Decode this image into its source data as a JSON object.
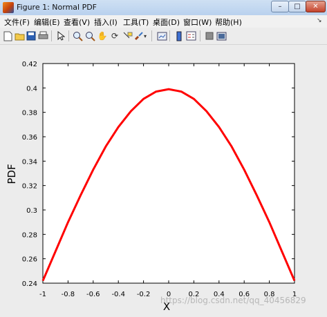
{
  "window": {
    "title": "Figure 1: Normal PDF"
  },
  "menu": [
    {
      "label": "文件(F)"
    },
    {
      "label": "编辑(E)"
    },
    {
      "label": "查看(V)"
    },
    {
      "label": "插入(I)"
    },
    {
      "label": "工具(T)"
    },
    {
      "label": "桌面(D)"
    },
    {
      "label": "窗口(W)"
    },
    {
      "label": "帮助(H)"
    }
  ],
  "toolbar": [
    {
      "icon": "new-figure-icon"
    },
    {
      "icon": "open-file-icon"
    },
    {
      "icon": "save-icon"
    },
    {
      "icon": "print-icon"
    },
    {
      "icon": "edit-plot-arrow-icon"
    },
    {
      "icon": "zoom-in-icon"
    },
    {
      "icon": "zoom-out-icon"
    },
    {
      "icon": "pan-hand-icon"
    },
    {
      "icon": "rotate-3d-icon"
    },
    {
      "icon": "data-cursor-icon"
    },
    {
      "icon": "brush-icon"
    },
    {
      "icon": "brush-dropdown-icon"
    },
    {
      "icon": "link-plot-icon"
    },
    {
      "icon": "insert-colorbar-icon"
    },
    {
      "icon": "insert-legend-icon"
    },
    {
      "icon": "hide-plot-tools-icon"
    },
    {
      "icon": "show-plot-tools-icon"
    }
  ],
  "watermark": "https://blog.csdn.net/qq_40456829",
  "chart_data": {
    "type": "line",
    "xlabel": "X",
    "ylabel": "PDF",
    "xlim": [
      -1,
      1
    ],
    "ylim": [
      0.24,
      0.42
    ],
    "xticks": [
      "-1",
      "-0.8",
      "-0.6",
      "-0.4",
      "-0.2",
      "0",
      "0.2",
      "0.4",
      "0.6",
      "0.8",
      "1"
    ],
    "yticks": [
      "0.24",
      "0.26",
      "0.28",
      "0.3",
      "0.32",
      "0.34",
      "0.36",
      "0.38",
      "0.4",
      "0.42"
    ],
    "grid": false,
    "color": "#ff0000",
    "series": [
      {
        "x": [
          -1,
          -0.9,
          -0.8,
          -0.7,
          -0.6,
          -0.5,
          -0.4,
          -0.3,
          -0.2,
          -0.1,
          0,
          0.1,
          0.2,
          0.3,
          0.4,
          0.5,
          0.6,
          0.7,
          0.8,
          0.9,
          1
        ],
        "values": [
          0.242,
          0.266,
          0.29,
          0.312,
          0.333,
          0.352,
          0.368,
          0.381,
          0.391,
          0.397,
          0.399,
          0.397,
          0.391,
          0.381,
          0.368,
          0.352,
          0.333,
          0.312,
          0.29,
          0.266,
          0.242
        ]
      }
    ]
  }
}
